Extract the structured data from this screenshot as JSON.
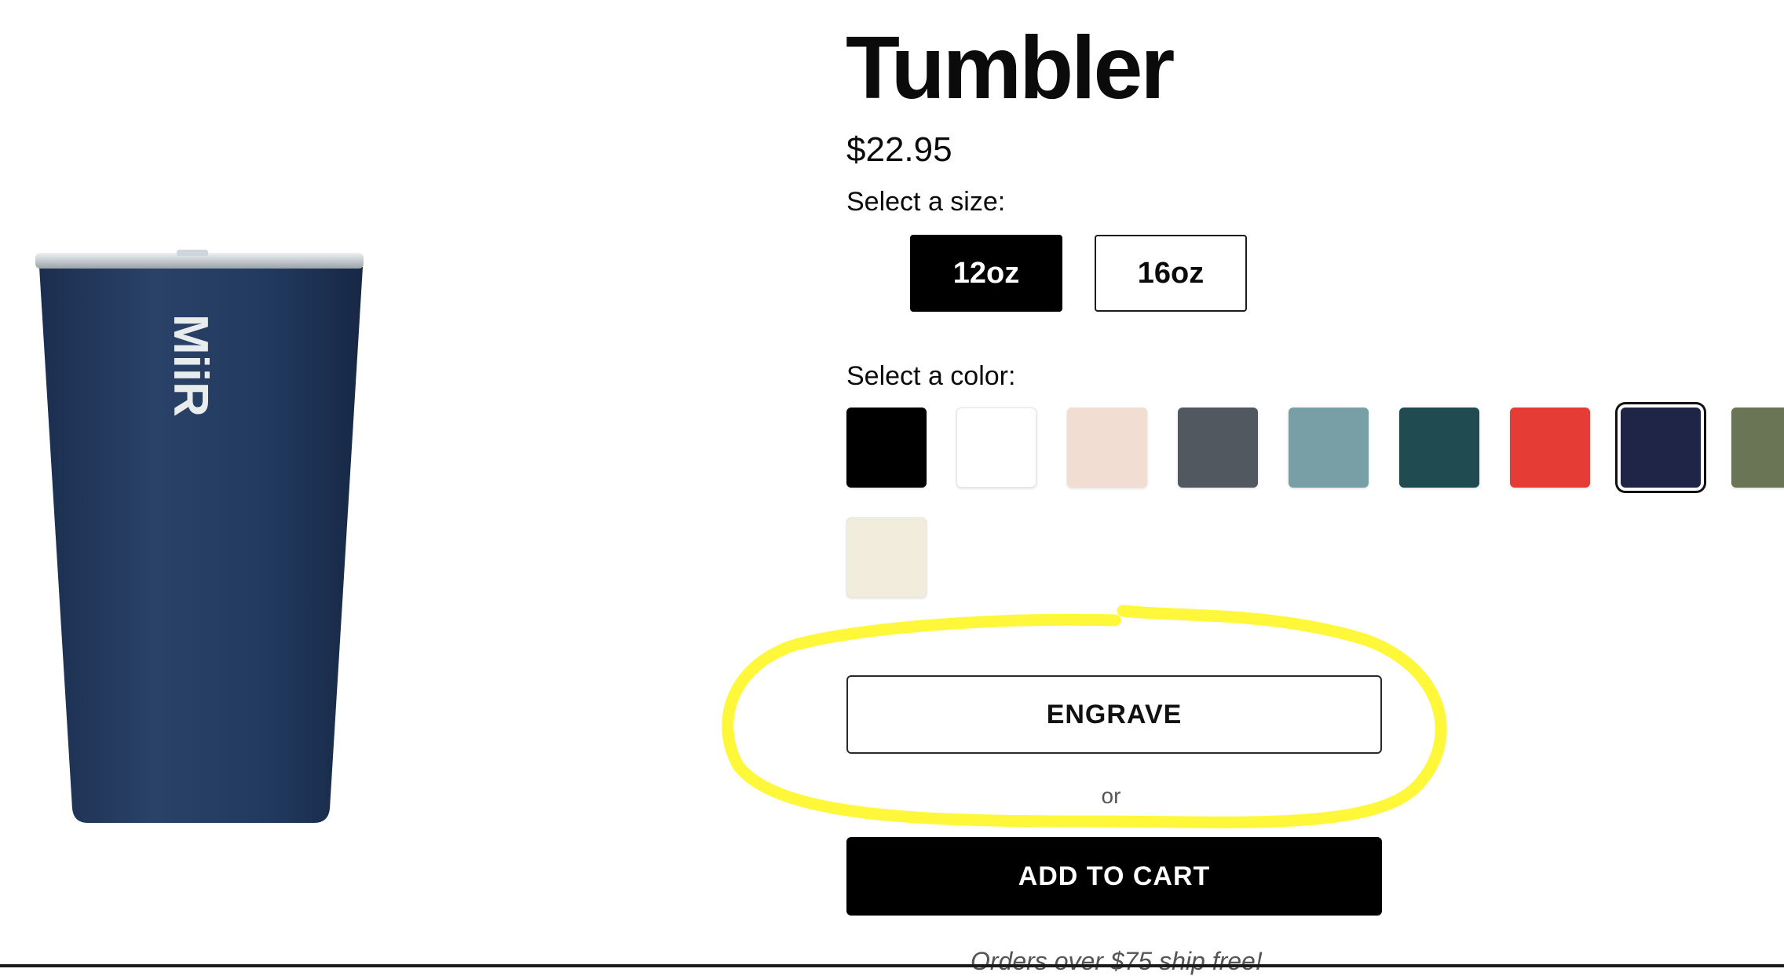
{
  "product": {
    "title": "Tumbler",
    "price": "$22.95",
    "brand_mark": "MiiR"
  },
  "size": {
    "label": "Select a size:",
    "options": [
      "12oz",
      "16oz"
    ],
    "selected": "12oz"
  },
  "color": {
    "label": "Select a color:",
    "swatches": [
      "#000000",
      "#ffffff",
      "#f2ddd2",
      "#51585f",
      "#789fa6",
      "#1f4b51",
      "#e53d35",
      "#1e2546",
      "#6a7555",
      "#f2ecdd"
    ],
    "selected": "#1e2546"
  },
  "actions": {
    "engrave_label": "ENGRAVE",
    "or_text": "or",
    "add_to_cart_label": "ADD TO CART"
  },
  "shipping_note": "Orders over $75 ship free!",
  "annotation": {
    "highlight_color": "#fff73a"
  }
}
